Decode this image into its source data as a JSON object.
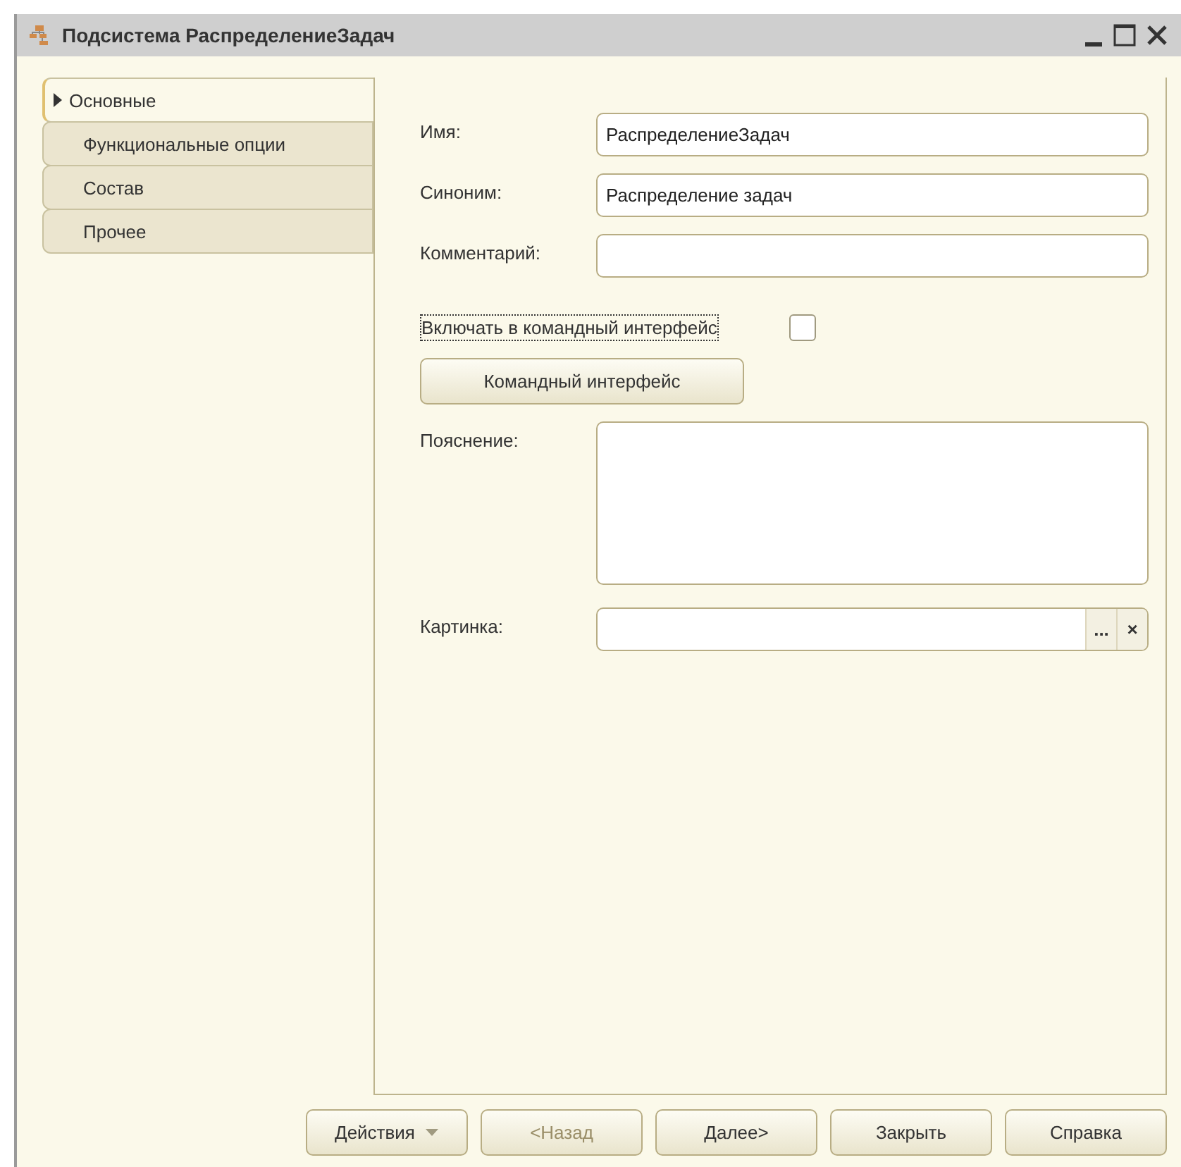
{
  "window": {
    "title": "Подсистема РаспределениеЗадач"
  },
  "tabs": [
    {
      "label": "Основные",
      "selected": true
    },
    {
      "label": "Функциональные опции",
      "selected": false
    },
    {
      "label": "Состав",
      "selected": false
    },
    {
      "label": "Прочее",
      "selected": false
    }
  ],
  "fields": [
    {
      "kind": "text",
      "label": "Имя:",
      "value": "РаспределениеЗадач"
    },
    {
      "kind": "text",
      "label": "Синоним:",
      "value": "Распределение задач"
    },
    {
      "kind": "text",
      "label": "Комментарий:"
    }
  ],
  "include_checkbox": {
    "label": "Включать в командный интерфейс",
    "checked": false
  },
  "command_interface_button": {
    "label": "Командный интерфейс"
  },
  "explanation": {
    "label": "Пояснение:"
  },
  "picture": {
    "label": "Картинка:",
    "choose": "...",
    "clear": "×"
  },
  "buttons": [
    {
      "label": "Действия",
      "kind": "menu",
      "disabled": false
    },
    {
      "label": "<Назад",
      "kind": "plain",
      "disabled": true
    },
    {
      "label": "Далее>",
      "kind": "plain",
      "disabled": false
    },
    {
      "label": "Закрыть",
      "kind": "plain",
      "disabled": false
    },
    {
      "label": "Справка",
      "kind": "plain",
      "disabled": false
    }
  ]
}
